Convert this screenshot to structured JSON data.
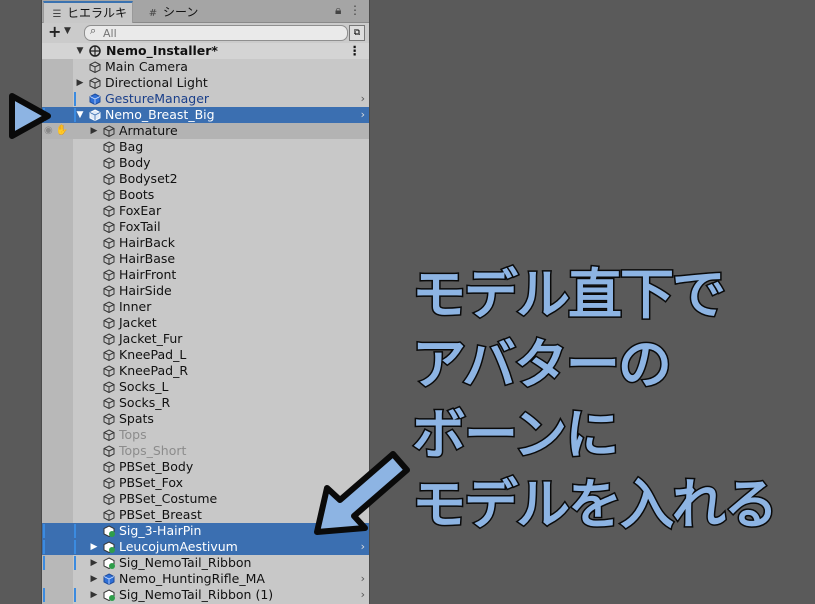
{
  "tabs": {
    "hierarchy": "ヒエラルキー",
    "scene": "シーン"
  },
  "search": {
    "placeholder": "All"
  },
  "scene_root": "Nemo_Installer*",
  "rows": [
    {
      "label": "Main Camera"
    },
    {
      "label": "Directional Light"
    },
    {
      "label": "GestureManager"
    },
    {
      "label": "Nemo_Breast_Big"
    },
    {
      "label": "Armature"
    },
    {
      "label": "Bag"
    },
    {
      "label": "Body"
    },
    {
      "label": "Bodyset2"
    },
    {
      "label": "Boots"
    },
    {
      "label": "FoxEar"
    },
    {
      "label": "FoxTail"
    },
    {
      "label": "HairBack"
    },
    {
      "label": "HairBase"
    },
    {
      "label": "HairFront"
    },
    {
      "label": "HairSide"
    },
    {
      "label": "Inner"
    },
    {
      "label": "Jacket"
    },
    {
      "label": "Jacket_Fur"
    },
    {
      "label": "KneePad_L"
    },
    {
      "label": "KneePad_R"
    },
    {
      "label": "Socks_L"
    },
    {
      "label": "Socks_R"
    },
    {
      "label": "Spats"
    },
    {
      "label": "Tops"
    },
    {
      "label": "Tops_Short"
    },
    {
      "label": "PBSet_Body"
    },
    {
      "label": "PBSet_Fox"
    },
    {
      "label": "PBSet_Costume"
    },
    {
      "label": "PBSet_Breast"
    },
    {
      "label": "Sig_3-HairPin"
    },
    {
      "label": "LeucojumAestivum"
    },
    {
      "label": "Sig_NemoTail_Ribbon"
    },
    {
      "label": "Nemo_HuntingRifle_MA"
    },
    {
      "label": "Sig_NemoTail_Ribbon (1)"
    }
  ],
  "callout": {
    "line1": "モデル直下で",
    "line2": "アバターの",
    "line3": "ボーンに",
    "line4": "モデルを入れる"
  },
  "colors": {
    "selection": "#3b6fb1",
    "callout_fill": "#8db4e3",
    "arrow_fill": "#8db4e3"
  }
}
